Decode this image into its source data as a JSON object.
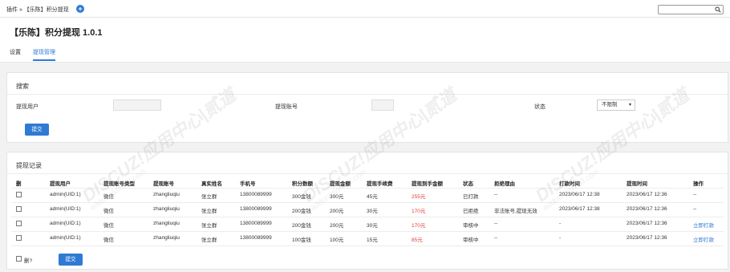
{
  "topbar": {
    "breadcrumb": "插件 » 【乐陈】积分提现",
    "search_value": ""
  },
  "header": {
    "title": "【乐陈】积分提现 1.0.1",
    "tabs": [
      {
        "label": "设置",
        "active": false
      },
      {
        "label": "提现管理",
        "active": true
      }
    ]
  },
  "search_panel": {
    "title": "搜索",
    "user_label": "提现用户",
    "user_value": "",
    "account_label": "提现账号",
    "account_value": "",
    "status_label": "状态",
    "status_selected": "不限制",
    "submit_label": "提交"
  },
  "records_panel": {
    "title": "提现记录",
    "columns": [
      "删",
      "提现用户",
      "提现账号类型",
      "提现账号",
      "真实姓名",
      "手机号",
      "积分数额",
      "提现金额",
      "提现手续费",
      "提现到手金额",
      "状态",
      "拒绝理由",
      "打款时间",
      "提现时间",
      "操作"
    ],
    "rows": [
      {
        "user": "admin(UID:1)",
        "type": "微信",
        "account": "zhangliuqiu",
        "name": "张立群",
        "phone": "13800089999",
        "points": "300金钱",
        "amount": "300元",
        "fee": "45元",
        "net": "255元",
        "status": "已打款",
        "reason": "--",
        "paid_time": "2023/06/17 12:38",
        "time": "2023/06/17 12:36",
        "action": "--"
      },
      {
        "user": "admin(UID:1)",
        "type": "微信",
        "account": "zhangliuqiu",
        "name": "张立群",
        "phone": "13800089999",
        "points": "200金钱",
        "amount": "200元",
        "fee": "30元",
        "net": "170元",
        "status": "已拒绝",
        "reason": "非法账号,提现无效",
        "paid_time": "2023/06/17 12:38",
        "time": "2023/06/17 12:36",
        "action": "--"
      },
      {
        "user": "admin(UID:1)",
        "type": "微信",
        "account": "zhangliuqiu",
        "name": "张立群",
        "phone": "13800089999",
        "points": "200金钱",
        "amount": "200元",
        "fee": "30元",
        "net": "170元",
        "status": "审核中",
        "reason": "--",
        "paid_time": "-",
        "time": "2023/06/17 12:36",
        "action": "立即打款"
      },
      {
        "user": "admin(UID:1)",
        "type": "微信",
        "account": "zhangliuqiu",
        "name": "张立群",
        "phone": "13800089999",
        "points": "100金钱",
        "amount": "100元",
        "fee": "15元",
        "net": "85元",
        "status": "审核中",
        "reason": "--",
        "paid_time": "-",
        "time": "2023/06/17 12:36",
        "action": "立即打款"
      }
    ],
    "delete_label": "删?",
    "submit_label": "提交"
  },
  "watermark": {
    "brand": "DISCUZ!应用中心|贰道",
    "domain": "addon.dismall.com"
  },
  "colors": {
    "accent": "#2f7ad3",
    "amount_red": "#e03b3b"
  }
}
